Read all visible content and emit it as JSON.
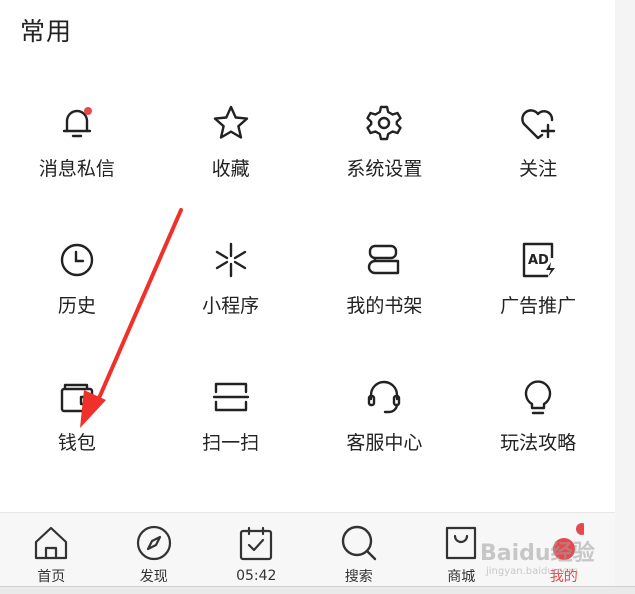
{
  "section": {
    "title": "常用"
  },
  "items": [
    {
      "label": "消息私信",
      "icon": "bell-icon"
    },
    {
      "label": "收藏",
      "icon": "star-icon"
    },
    {
      "label": "系统设置",
      "icon": "gear-icon"
    },
    {
      "label": "关注",
      "icon": "heart-plus-icon"
    },
    {
      "label": "历史",
      "icon": "clock-icon"
    },
    {
      "label": "小程序",
      "icon": "mini-program-icon"
    },
    {
      "label": "我的书架",
      "icon": "bookshelf-icon"
    },
    {
      "label": "广告推广",
      "icon": "ad-icon"
    },
    {
      "label": "钱包",
      "icon": "wallet-icon"
    },
    {
      "label": "扫一扫",
      "icon": "scan-icon"
    },
    {
      "label": "客服中心",
      "icon": "headset-icon"
    },
    {
      "label": "玩法攻略",
      "icon": "bulb-icon"
    }
  ],
  "tabbar": [
    {
      "label": "首页",
      "icon": "home-icon"
    },
    {
      "label": "发现",
      "icon": "compass-icon"
    },
    {
      "label": "05:42",
      "icon": "calendar-check-icon"
    },
    {
      "label": "搜索",
      "icon": "search-icon"
    },
    {
      "label": "商城",
      "icon": "shopping-bag-icon"
    },
    {
      "label": "我的",
      "icon": "profile-dots-icon",
      "active": true
    }
  ],
  "colors": {
    "accent": "#e5484d",
    "annotation_arrow": "#f0302a"
  },
  "watermark": {
    "text": "Baidu经验",
    "sub": "jingyan.baidu.com"
  }
}
